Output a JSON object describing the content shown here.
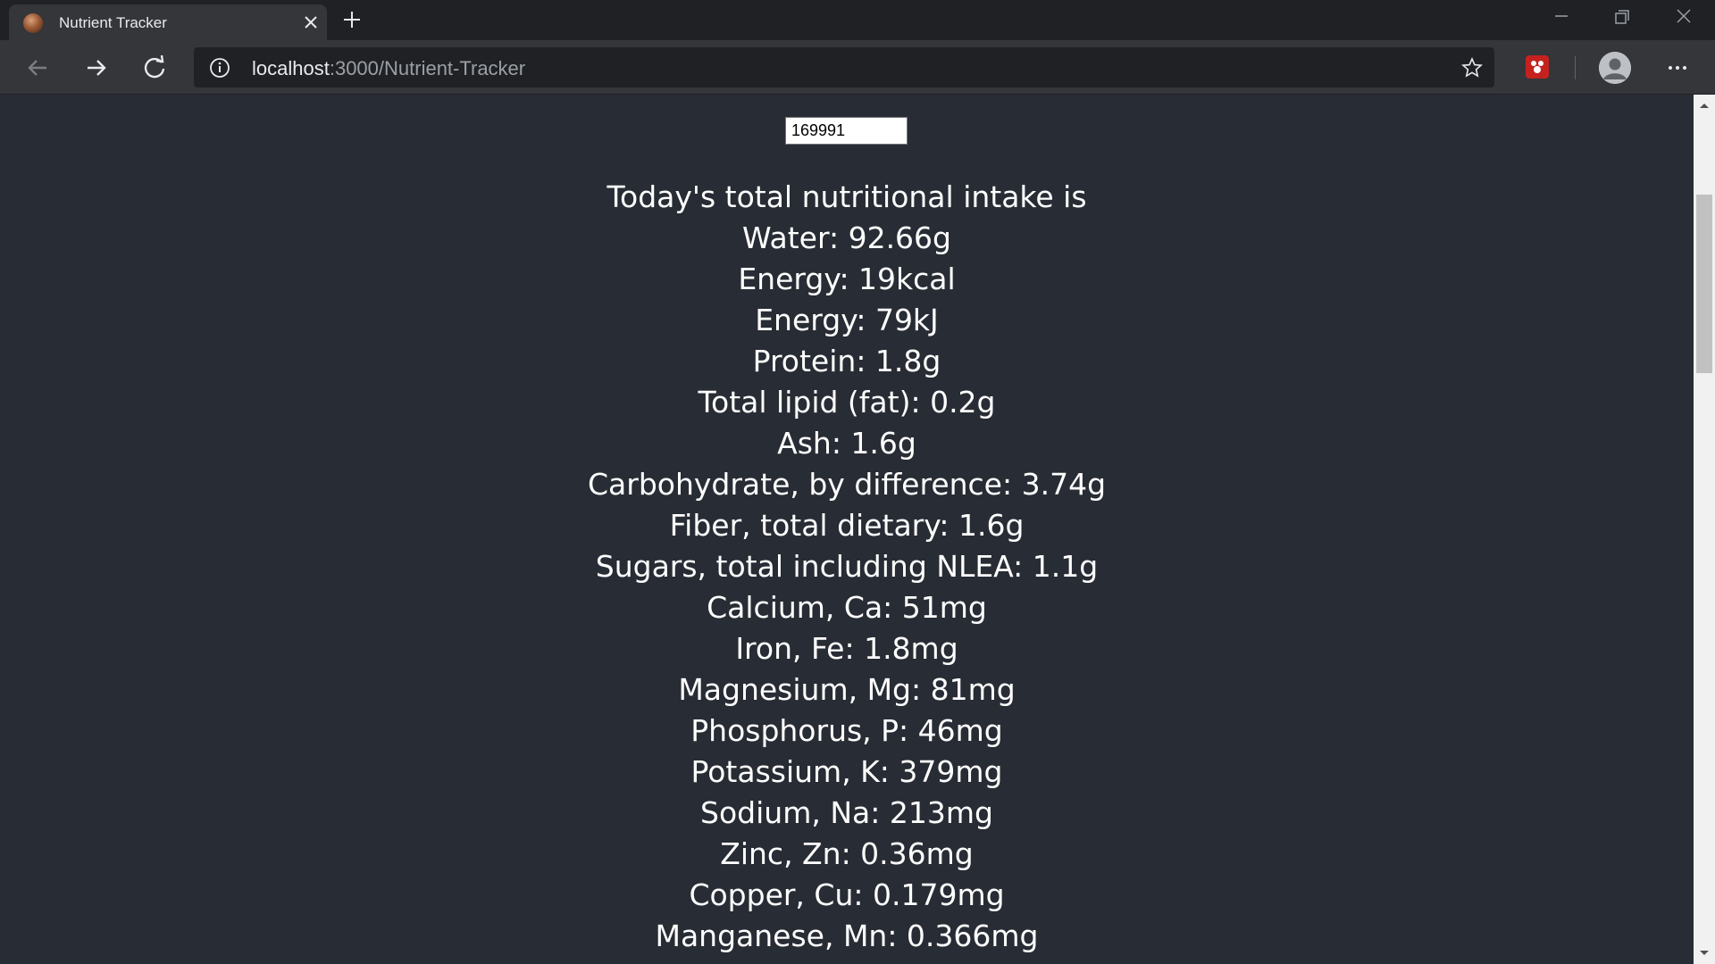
{
  "browser": {
    "tab": {
      "title": "Nutrient Tracker"
    },
    "address": {
      "host": "localhost",
      "path": ":3000/Nutrient-Tracker"
    }
  },
  "page": {
    "search_input_value": "169991",
    "heading": "Today's total nutritional intake is",
    "nutrients": [
      "Water: 92.66g",
      "Energy: 19kcal",
      "Energy: 79kJ",
      "Protein: 1.8g",
      "Total lipid (fat): 0.2g",
      "Ash: 1.6g",
      "Carbohydrate, by difference: 3.74g",
      "Fiber, total dietary: 1.6g",
      "Sugars, total including NLEA: 1.1g",
      "Calcium, Ca: 51mg",
      "Iron, Fe: 1.8mg",
      "Magnesium, Mg: 81mg",
      "Phosphorus, P: 46mg",
      "Potassium, K: 379mg",
      "Sodium, Na: 213mg",
      "Zinc, Zn: 0.36mg",
      "Copper, Cu: 0.179mg",
      "Manganese, Mn: 0.366mg"
    ]
  },
  "icons": {
    "favicon": "food-favicon-icon",
    "extension": "extension-icon"
  },
  "colors": {
    "page_background": "#282c34",
    "text": "#ffffff",
    "chrome_dark": "#202124",
    "chrome_toolbar": "#35363a"
  }
}
